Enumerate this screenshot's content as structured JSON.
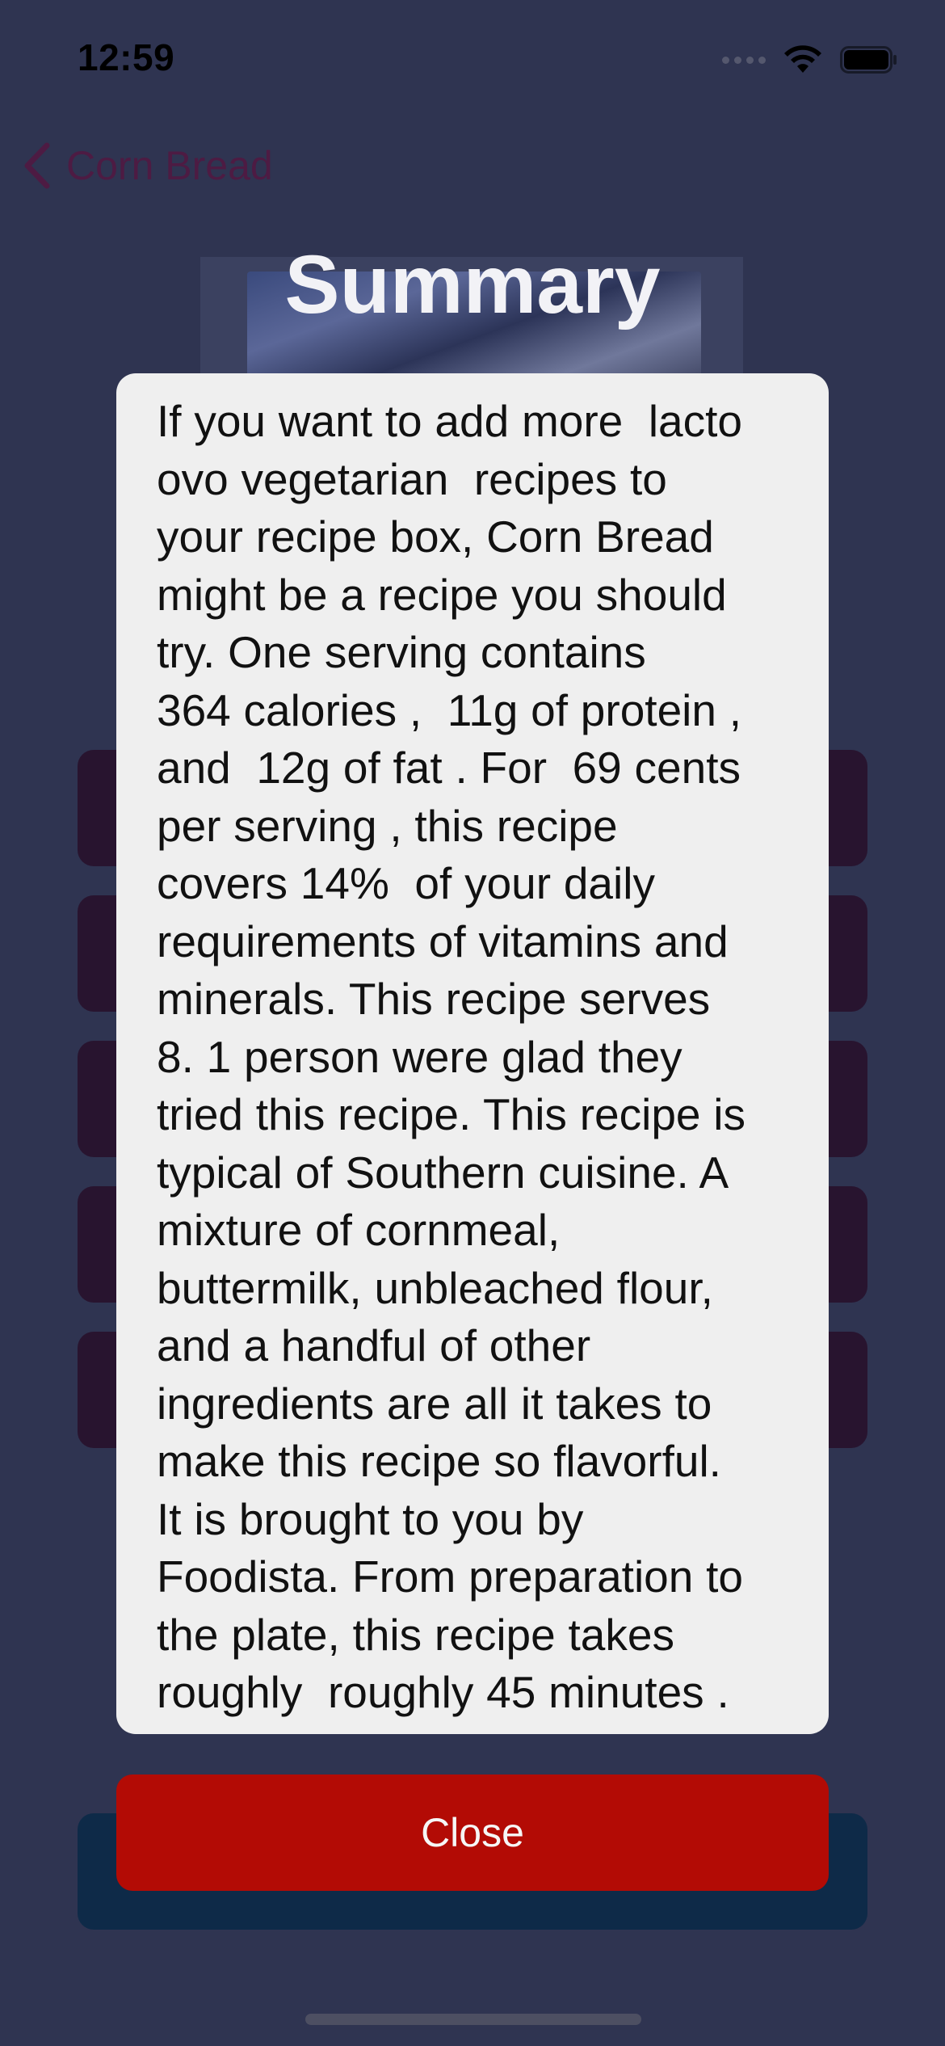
{
  "status_bar": {
    "time": "12:59"
  },
  "nav": {
    "back_label": "Corn Bread"
  },
  "page": {
    "title": "Summary"
  },
  "modal": {
    "lines": [
      "If you want to add more  lacto",
      "ovo vegetarian  recipes to",
      "your recipe box, Corn Bread",
      "might be a recipe you should",
      "try. One serving contains",
      "364 calories ,  11g of protein ,",
      "and  12g of fat . For  69 cents",
      "per serving , this recipe",
      "covers 14%  of your daily",
      "requirements of vitamins and",
      "minerals. This recipe serves",
      "8. 1 person were glad they",
      "tried this recipe. This recipe is",
      "typical of Southern cuisine. A",
      "mixture of cornmeal,",
      "buttermilk, unbleached flour,",
      "and a handful of other",
      "ingredients are all it takes to",
      "make this recipe so flavorful.",
      "It is brought to you by",
      "Foodista. From preparation to",
      "the plate, this recipe takes",
      "roughly  roughly 45 minutes ."
    ],
    "close_label": "Close"
  },
  "colors": {
    "background": "#2f3451",
    "modal_background": "#efefef",
    "close_button": "#b30b05",
    "nav_accent": "#4d1b43",
    "background_button": "#28142f",
    "background_wide_button": "#0e2a48"
  },
  "icons": {
    "back": "chevron-left-icon",
    "wifi": "wifi-icon",
    "battery": "battery-icon",
    "signal": "cellular-signal-icon"
  }
}
